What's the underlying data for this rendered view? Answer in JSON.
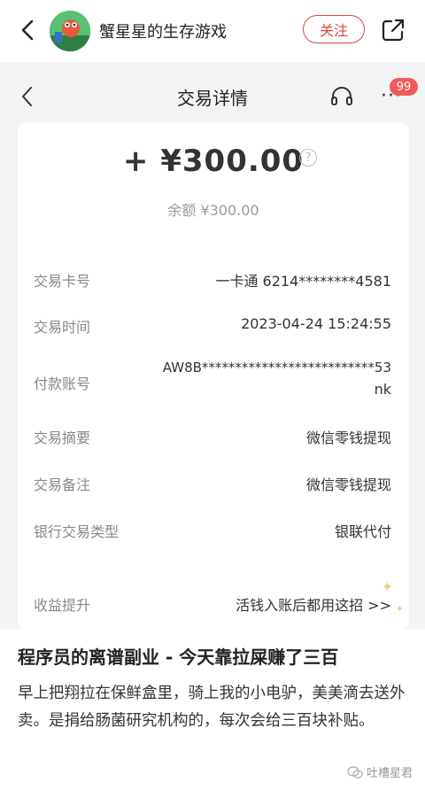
{
  "header": {
    "author_name": "蟹星星的生存游戏",
    "follow_label": "关注"
  },
  "screenshot": {
    "nav_title": "交易详情",
    "badge_count": "99",
    "amount": "+ ¥300.00",
    "help_symbol": "?",
    "balance": "余额 ¥300.00",
    "rows": [
      {
        "label": "交易卡号",
        "value": "一卡通 6214********4581"
      },
      {
        "label": "交易时间",
        "value": "2023-04-24 15:24:55"
      },
      {
        "label": "付款账号",
        "value_line1": "AW8B**************************53",
        "value_line2": "nk"
      },
      {
        "label": "交易摘要",
        "value": "微信零钱提现"
      },
      {
        "label": "交易备注",
        "value": "微信零钱提现"
      },
      {
        "label": "银行交易类型",
        "value": "银联代付"
      }
    ],
    "income": {
      "label": "收益提升",
      "link": "活钱入账后都用这招 >>"
    }
  },
  "article": {
    "title": "程序员的离谱副业 - 今天靠拉屎赚了三百",
    "body": "早上把翔拉在保鲜盒里，骑上我的小电驴，美美滴去送外卖。是捐给肠菌研究机构的，每次会给三百块补贴。"
  },
  "watermark": "吐槽星君",
  "colors": {
    "accent_red": "#e0443e",
    "badge_red": "#f25a5a",
    "screenshot_bg": "#f4f4f6"
  }
}
